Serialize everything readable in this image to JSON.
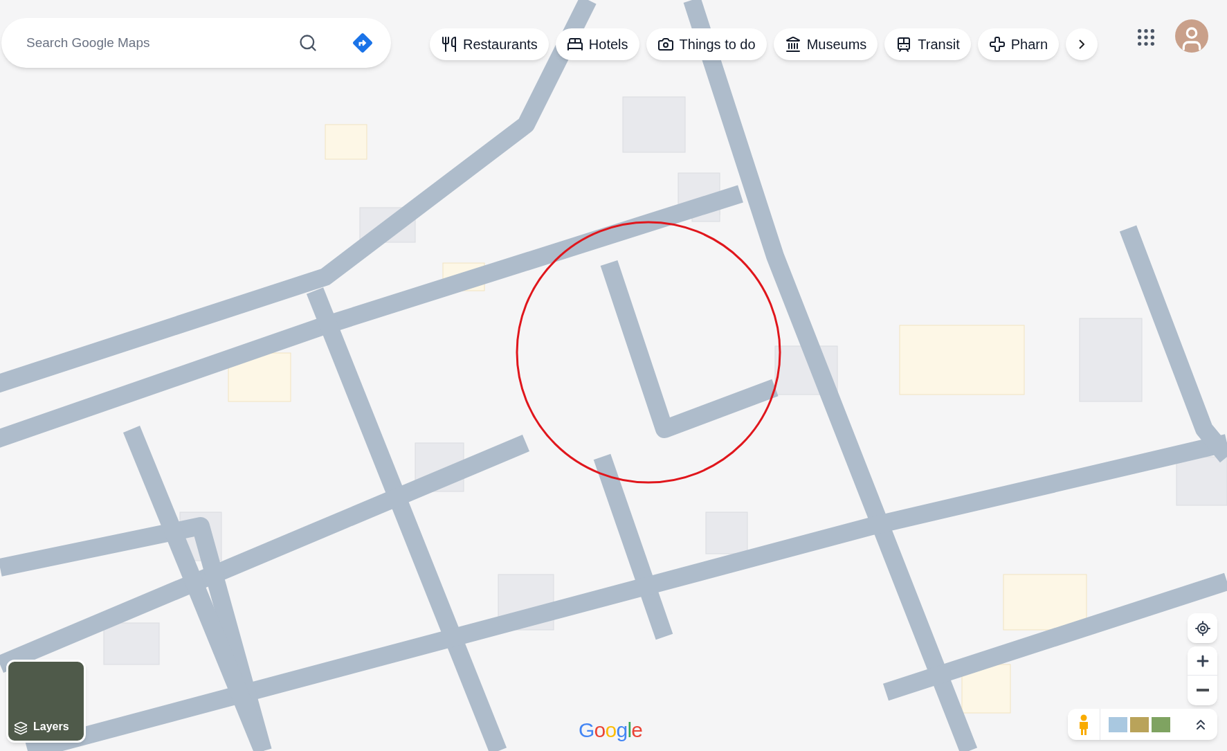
{
  "search": {
    "placeholder": "Search Google Maps"
  },
  "chips": [
    {
      "kind": "restaurant",
      "label": "Restaurants"
    },
    {
      "kind": "hotel",
      "label": "Hotels"
    },
    {
      "kind": "camera",
      "label": "Things to do"
    },
    {
      "kind": "museum",
      "label": "Museums"
    },
    {
      "kind": "transit",
      "label": "Transit"
    },
    {
      "kind": "pharmacy",
      "label": "Pharn"
    }
  ],
  "layers": {
    "label": "Layers"
  },
  "logo": "Google"
}
